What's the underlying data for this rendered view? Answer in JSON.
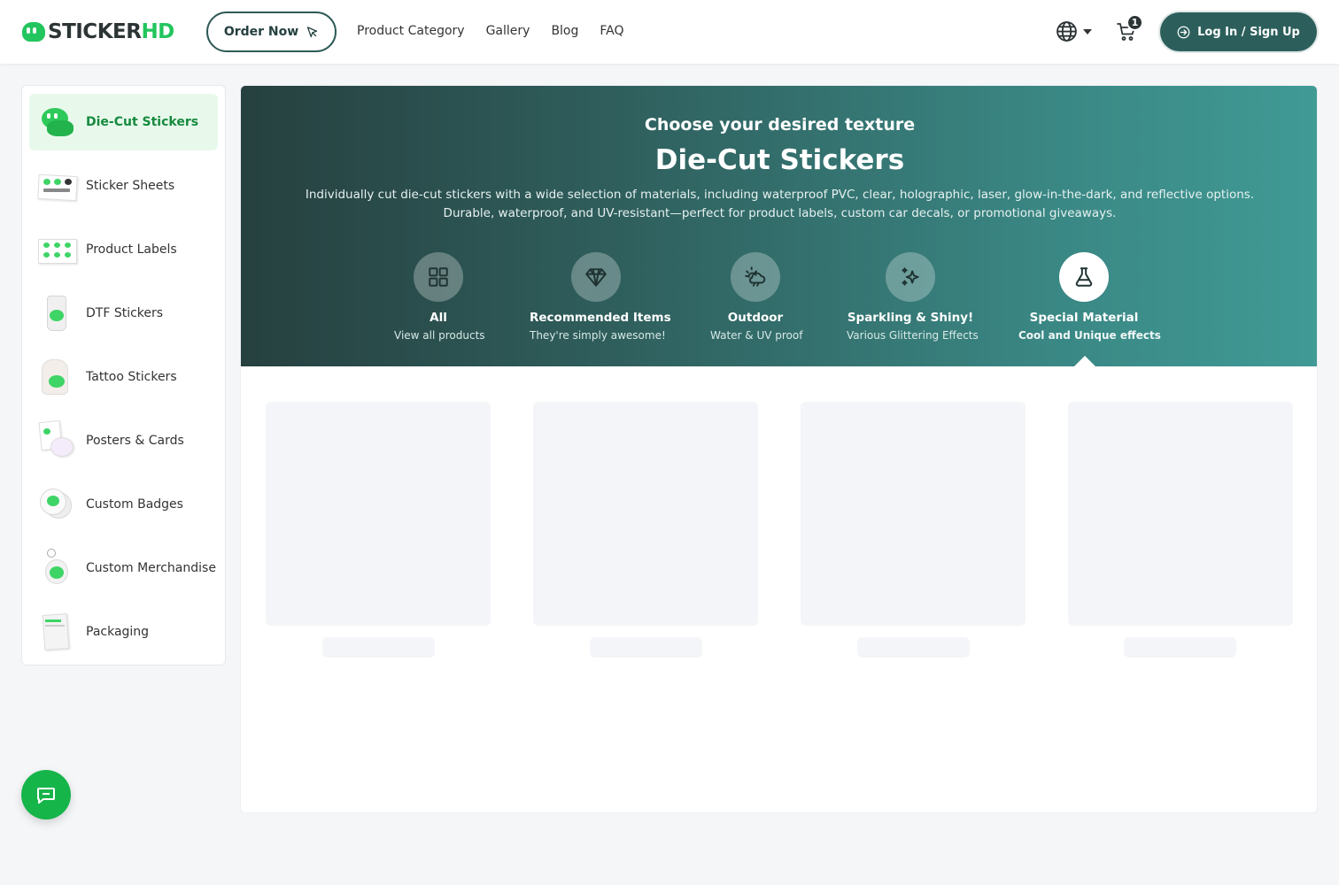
{
  "brand": {
    "name_main": "STICKER",
    "name_accent": "HD",
    "accent_color": "#22c55e",
    "primary_color": "#2c5f5b"
  },
  "header": {
    "order_label": "Order Now",
    "nav": [
      "Product Category",
      "Gallery",
      "Blog",
      "FAQ"
    ],
    "cart_count": "1",
    "login_label": "Log In / Sign Up"
  },
  "sidebar": {
    "items": [
      {
        "label": "Die-Cut Stickers",
        "icon": "die-cut-sticker-icon",
        "active": true
      },
      {
        "label": "Sticker Sheets",
        "icon": "sticker-sheet-icon"
      },
      {
        "label": "Product Labels",
        "icon": "product-label-icon"
      },
      {
        "label": "DTF Stickers",
        "icon": "dtf-sticker-icon"
      },
      {
        "label": "Tattoo Stickers",
        "icon": "tattoo-sticker-icon"
      },
      {
        "label": "Posters & Cards",
        "icon": "poster-card-icon"
      },
      {
        "label": "Custom Badges",
        "icon": "badge-icon"
      },
      {
        "label": "Custom Merchandise",
        "icon": "merchandise-icon"
      },
      {
        "label": "Packaging",
        "icon": "packaging-icon"
      }
    ]
  },
  "banner": {
    "subtitle": "Choose your desired texture",
    "title": "Die-Cut Stickers",
    "description": "Individually cut die-cut stickers with a wide selection of materials, including waterproof PVC, clear, holographic, laser, glow-in-the-dark, and reflective options. Durable, waterproof, and UV-resistant—perfect for product labels, custom car decals, or promotional giveaways.",
    "textures": [
      {
        "name": "All",
        "sub": "View all products",
        "icon": "grid-icon"
      },
      {
        "name": "Recommended Items",
        "sub": "They're simply awesome!",
        "icon": "diamond-icon"
      },
      {
        "name": "Outdoor",
        "sub": "Water & UV proof",
        "icon": "weather-icon"
      },
      {
        "name": "Sparkling & Shiny!",
        "sub": "Various Glittering Effects",
        "icon": "sparkle-icon"
      },
      {
        "name": "Special Material",
        "sub": "Cool and Unique effects",
        "icon": "flask-icon",
        "active": true
      }
    ]
  }
}
